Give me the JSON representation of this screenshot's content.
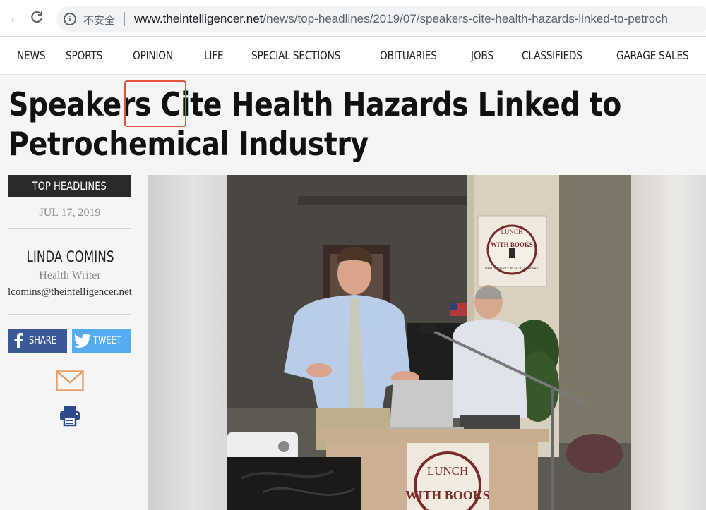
{
  "browser": {
    "insecure_label": "不安全",
    "url_host": "www.theintelligencer.net",
    "url_path": "/news/top-headlines/2019/07/speakers-cite-health-hazards-linked-to-petroch"
  },
  "nav": {
    "items": [
      "NEWS",
      "SPORTS",
      "OPINION",
      "LIFE",
      "SPECIAL SECTIONS",
      "OBITUARIES",
      "JOBS",
      "CLASSIFIEDS",
      "GARAGE SALES"
    ]
  },
  "article": {
    "headline_word_1": "Speakers",
    "headline_word_highlight": "Cite",
    "headline_rest": "Health Hazards Linked to Petrochemical Industry",
    "section": "TOP HEADLINES",
    "date": "JUL 17, 2019",
    "author": "LINDA COMINS",
    "role": "Health Writer",
    "email": "lcomins@theintelligencer.net"
  },
  "share": {
    "facebook_label": "SHARE",
    "twitter_label": "TWEET"
  },
  "photo": {
    "sign_text_top": "LUNCH",
    "sign_text_bottom": "WITH BOOKS",
    "poster_text_top": "LUNCH",
    "poster_text_mid": "WITH BOOKS",
    "poster_text_bottom": "OHIO COUNTY PUBLIC LIBRARY"
  },
  "colors": {
    "highlight_border": "#e0533a",
    "facebook": "#3b5998",
    "twitter": "#55acee",
    "email_icon": "#e3a06a",
    "print_icon": "#2f4a8a"
  }
}
